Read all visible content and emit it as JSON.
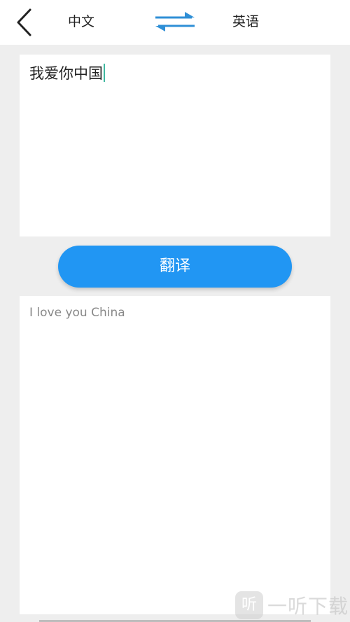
{
  "header": {
    "source_language": "中文",
    "target_language": "英语",
    "back_icon": "chevron-left-icon",
    "swap_icon": "swap-arrows-icon"
  },
  "input": {
    "text": "我爱你中国"
  },
  "translate_button": {
    "label": "翻译"
  },
  "output": {
    "text": "I love you China"
  },
  "watermark": {
    "logo_char": "听",
    "text": "一听下载"
  },
  "colors": {
    "accent": "#2196f3",
    "swap_arrows": "#2f8fd6",
    "background": "#eeeeee",
    "panel": "#ffffff",
    "caret": "#3fb8a0"
  }
}
